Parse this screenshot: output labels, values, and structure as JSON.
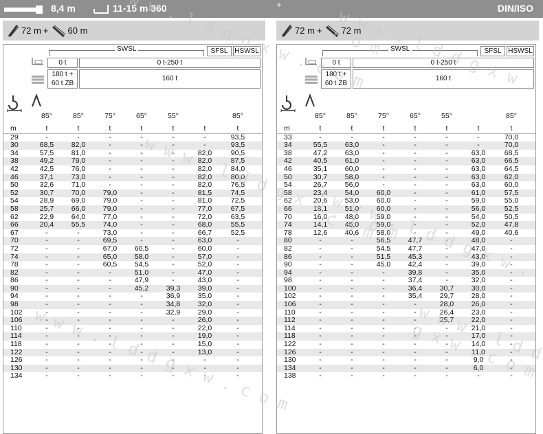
{
  "topbar": {
    "counterweight": "8,4 m",
    "outrigger": "11-15 m 360",
    "degree_mark": "°",
    "standard": "DIN/ISO"
  },
  "watermark": "w w w . l d d g x w . c o m",
  "panels": [
    {
      "config": {
        "boom": "72 m",
        "plus": "+",
        "jib": "60 m"
      },
      "header": {
        "swsl": "SWSL",
        "sfsl": "SFSL",
        "hswsl": "HSWSL",
        "ballast_left": "0 t",
        "ballast_right": "0 t-250 t",
        "super_left": "180 t +\n60 t ZB",
        "super_right": "160 t",
        "angles": [
          "85°",
          "85°",
          "75°",
          "65°",
          "55°",
          "",
          "85°"
        ],
        "units": [
          "m",
          "t",
          "t",
          "t",
          "t",
          "t",
          "t",
          "t"
        ]
      },
      "rows": [
        [
          "29",
          "-",
          "-",
          "-",
          "-",
          "-",
          "-",
          "93,5"
        ],
        [
          "30",
          "68,5",
          "82,0",
          "-",
          "-",
          "-",
          "-",
          "93,5"
        ],
        [
          "34",
          "57,5",
          "81,0",
          "-",
          "-",
          "-",
          "82,0",
          "90,5"
        ],
        [
          "38",
          "49,2",
          "79,0",
          "-",
          "-",
          "-",
          "82,0",
          "87,5"
        ],
        [
          "42",
          "42,5",
          "76,0",
          "-",
          "-",
          "-",
          "82,0",
          "84,0"
        ],
        [
          "46",
          "37,1",
          "73,0",
          "-",
          "-",
          "-",
          "82,0",
          "80,0"
        ],
        [
          "50",
          "32,6",
          "71,0",
          "-",
          "-",
          "-",
          "82,0",
          "76,5"
        ],
        [
          "52",
          "30,7",
          "70,0",
          "79,0",
          "-",
          "-",
          "81,5",
          "74,5"
        ],
        [
          "54",
          "28,9",
          "69,0",
          "79,0",
          "-",
          "-",
          "81,0",
          "72,5"
        ],
        [
          "58",
          "25,7",
          "66,0",
          "79,0",
          "-",
          "-",
          "77,0",
          "67,5"
        ],
        [
          "62",
          "22,9",
          "64,0",
          "77,0",
          "-",
          "-",
          "72,0",
          "63,5"
        ],
        [
          "66",
          "20,4",
          "55,5",
          "74,0",
          "-",
          "-",
          "68,0",
          "55,5"
        ],
        [
          "67",
          "-",
          "-",
          "73,0",
          "-",
          "-",
          "66,7",
          "52,5"
        ],
        [
          "70",
          "-",
          "-",
          "69,5",
          "-",
          "-",
          "63,0",
          "-"
        ],
        [
          "72",
          "-",
          "-",
          "67,0",
          "60,5",
          "-",
          "60,0",
          "-"
        ],
        [
          "74",
          "-",
          "-",
          "65,0",
          "58,0",
          "-",
          "57,0",
          "-"
        ],
        [
          "78",
          "-",
          "-",
          "60,5",
          "54,5",
          "-",
          "52,0",
          "-"
        ],
        [
          "82",
          "-",
          "-",
          "-",
          "51,0",
          "-",
          "47,0",
          "-"
        ],
        [
          "86",
          "-",
          "-",
          "-",
          "47,9",
          "-",
          "43,0",
          "-"
        ],
        [
          "90",
          "-",
          "-",
          "-",
          "45,2",
          "39,3",
          "39,0",
          "-"
        ],
        [
          "94",
          "-",
          "-",
          "-",
          "-",
          "36,9",
          "35,0",
          "-"
        ],
        [
          "98",
          "-",
          "-",
          "-",
          "-",
          "34,8",
          "32,0",
          "-"
        ],
        [
          "102",
          "-",
          "-",
          "-",
          "-",
          "32,9",
          "29,0",
          "-"
        ],
        [
          "106",
          "-",
          "-",
          "-",
          "-",
          "-",
          "26,0",
          "-"
        ],
        [
          "110",
          "-",
          "-",
          "-",
          "-",
          "-",
          "22,0",
          "-"
        ],
        [
          "114",
          "-",
          "-",
          "-",
          "-",
          "-",
          "19,0",
          "-"
        ],
        [
          "118",
          "-",
          "-",
          "-",
          "-",
          "-",
          "15,0",
          "-"
        ],
        [
          "122",
          "-",
          "-",
          "-",
          "-",
          "-",
          "13,0",
          "-"
        ],
        [
          "126",
          "-",
          "-",
          "-",
          "-",
          "-",
          "-",
          "-"
        ],
        [
          "130",
          "-",
          "-",
          "-",
          "-",
          "-",
          "-",
          "-"
        ],
        [
          "134",
          "-",
          "-",
          "-",
          "-",
          "-",
          "-",
          "-"
        ]
      ]
    },
    {
      "config": {
        "boom": "72 m",
        "plus": "+",
        "jib": "72 m"
      },
      "header": {
        "swsl": "SWSL",
        "sfsl": "SFSL",
        "hswsl": "HSWSL",
        "ballast_left": "0 t",
        "ballast_right": "0 t-250 t",
        "super_left": "180 t +\n60 t ZB",
        "super_right": "160 t",
        "angles": [
          "85°",
          "85°",
          "75°",
          "65°",
          "55°",
          "",
          "85°"
        ],
        "units": [
          "m",
          "t",
          "t",
          "t",
          "t",
          "t",
          "t",
          "t"
        ]
      },
      "rows": [
        [
          "33",
          "-",
          "-",
          "-",
          "-",
          "-",
          "-",
          "70,0"
        ],
        [
          "34",
          "55,5",
          "63,0",
          "-",
          "-",
          "-",
          "-",
          "70,0"
        ],
        [
          "38",
          "47,2",
          "63,0",
          "-",
          "-",
          "-",
          "63,0",
          "68,5"
        ],
        [
          "42",
          "40,5",
          "61,0",
          "-",
          "-",
          "-",
          "63,0",
          "66,5"
        ],
        [
          "46",
          "35,1",
          "60,0",
          "-",
          "-",
          "-",
          "63,0",
          "64,5"
        ],
        [
          "50",
          "30,7",
          "58,0",
          "-",
          "-",
          "-",
          "63,0",
          "62,0"
        ],
        [
          "54",
          "26,7",
          "56,0",
          "-",
          "-",
          "-",
          "63,0",
          "60,0"
        ],
        [
          "58",
          "23,4",
          "54,0",
          "60,0",
          "-",
          "-",
          "61,0",
          "57,5"
        ],
        [
          "62",
          "20,6",
          "53,0",
          "60,0",
          "-",
          "-",
          "59,0",
          "55,0"
        ],
        [
          "66",
          "18,1",
          "51,0",
          "60,0",
          "-",
          "-",
          "56,0",
          "52,5"
        ],
        [
          "70",
          "16,0",
          "48,0",
          "59,0",
          "-",
          "-",
          "54,0",
          "50,5"
        ],
        [
          "74",
          "14,1",
          "45,0",
          "59,0",
          "-",
          "-",
          "52,0",
          "47,8"
        ],
        [
          "78",
          "12,6",
          "40,6",
          "58,0",
          "-",
          "-",
          "49,0",
          "40,6"
        ],
        [
          "80",
          "-",
          "-",
          "56,5",
          "47,7",
          "-",
          "48,0",
          "-"
        ],
        [
          "82",
          "-",
          "-",
          "54,5",
          "47,7",
          "-",
          "47,0",
          "-"
        ],
        [
          "86",
          "-",
          "-",
          "51,5",
          "45,3",
          "-",
          "43,0",
          "-"
        ],
        [
          "90",
          "-",
          "-",
          "45,0",
          "42,4",
          "-",
          "39,0",
          "-"
        ],
        [
          "94",
          "-",
          "-",
          "-",
          "39,8",
          "-",
          "35,0",
          "-"
        ],
        [
          "98",
          "-",
          "-",
          "-",
          "37,4",
          "-",
          "32,0",
          "-"
        ],
        [
          "100",
          "-",
          "-",
          "-",
          "36,4",
          "30,7",
          "30,0",
          "-"
        ],
        [
          "102",
          "-",
          "-",
          "-",
          "35,4",
          "29,7",
          "28,0",
          "-"
        ],
        [
          "106",
          "-",
          "-",
          "-",
          "-",
          "28,0",
          "26,0",
          "-"
        ],
        [
          "110",
          "-",
          "-",
          "-",
          "-",
          "26,4",
          "23,0",
          "-"
        ],
        [
          "112",
          "-",
          "-",
          "-",
          "-",
          "25,7",
          "22,0",
          "-"
        ],
        [
          "114",
          "-",
          "-",
          "-",
          "-",
          "-",
          "21,0",
          "-"
        ],
        [
          "118",
          "-",
          "-",
          "-",
          "-",
          "-",
          "17,0",
          "-"
        ],
        [
          "122",
          "-",
          "-",
          "-",
          "-",
          "-",
          "14,0",
          "-"
        ],
        [
          "126",
          "-",
          "-",
          "-",
          "-",
          "-",
          "11,0",
          "-"
        ],
        [
          "130",
          "-",
          "-",
          "-",
          "-",
          "-",
          "9,0",
          "-"
        ],
        [
          "134",
          "-",
          "-",
          "-",
          "-",
          "-",
          "6,0",
          "-"
        ],
        [
          "138",
          "-",
          "-",
          "-",
          "-",
          "-",
          "-",
          "-"
        ]
      ]
    }
  ]
}
